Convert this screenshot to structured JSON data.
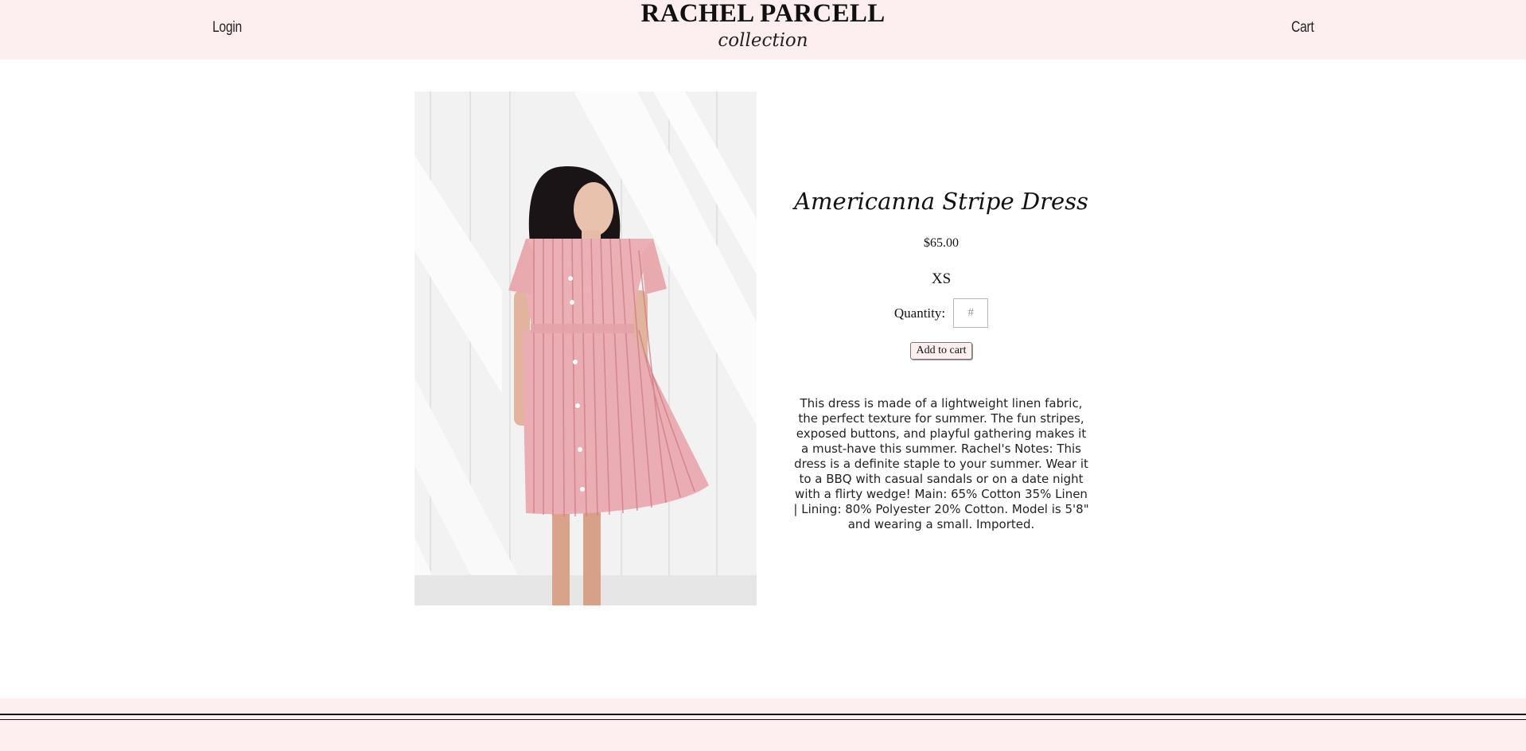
{
  "header": {
    "login_label": "Login",
    "cart_label": "Cart",
    "brand_name": "RACHEL PARCELL",
    "brand_sub": "collection"
  },
  "product": {
    "title": "Americanna Stripe Dress",
    "price": "$65.00",
    "size": "XS",
    "quantity_label": "Quantity:",
    "quantity_placeholder": "#",
    "add_to_cart_label": "Add to cart",
    "description": "This dress is made of a lightweight linen fabric, the perfect texture for summer. The fun stripes, exposed buttons, and playful gathering makes it a must-have this summer. Rachel's Notes: This dress is a definite staple to your summer. Wear it to a BBQ with casual sandals or on a date night with a flirty wedge! Main: 65% Cotton 35% Linen | Lining: 80% Polyester 20% Cotton. Model is 5'8\" and wearing a small. Imported."
  },
  "colors": {
    "header_bg": "#fdeeef",
    "footer_bg": "#fdeeef",
    "dress": "#e9a7ad"
  }
}
